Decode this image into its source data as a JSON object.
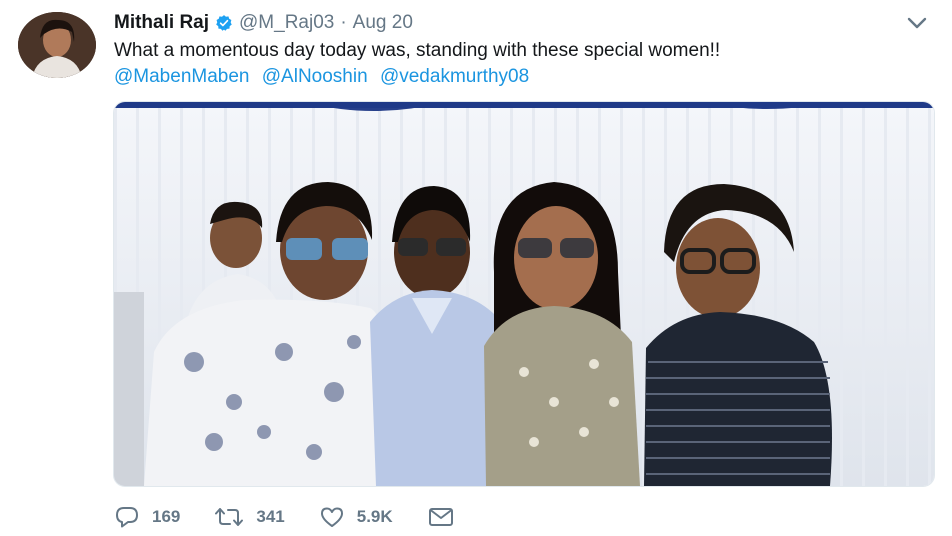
{
  "tweet": {
    "author_name": "Mithali Raj",
    "handle": "@M_Raj03",
    "separator": "·",
    "date": "Aug 20",
    "text": "What a momentous day today was, standing with these special women!!",
    "mentions": [
      "@MabenMaben",
      "@AlNooshin",
      "@vedakmurthy08"
    ]
  },
  "actions": {
    "replies": "169",
    "retweets": "341",
    "likes": "5.9K"
  },
  "colors": {
    "link": "#1b95e0",
    "muted": "#657786",
    "verified": "#1da1f2"
  },
  "icons": [
    "verified-badge-icon",
    "chevron-down-icon",
    "reply-icon",
    "retweet-icon",
    "like-icon",
    "direct-message-icon"
  ]
}
